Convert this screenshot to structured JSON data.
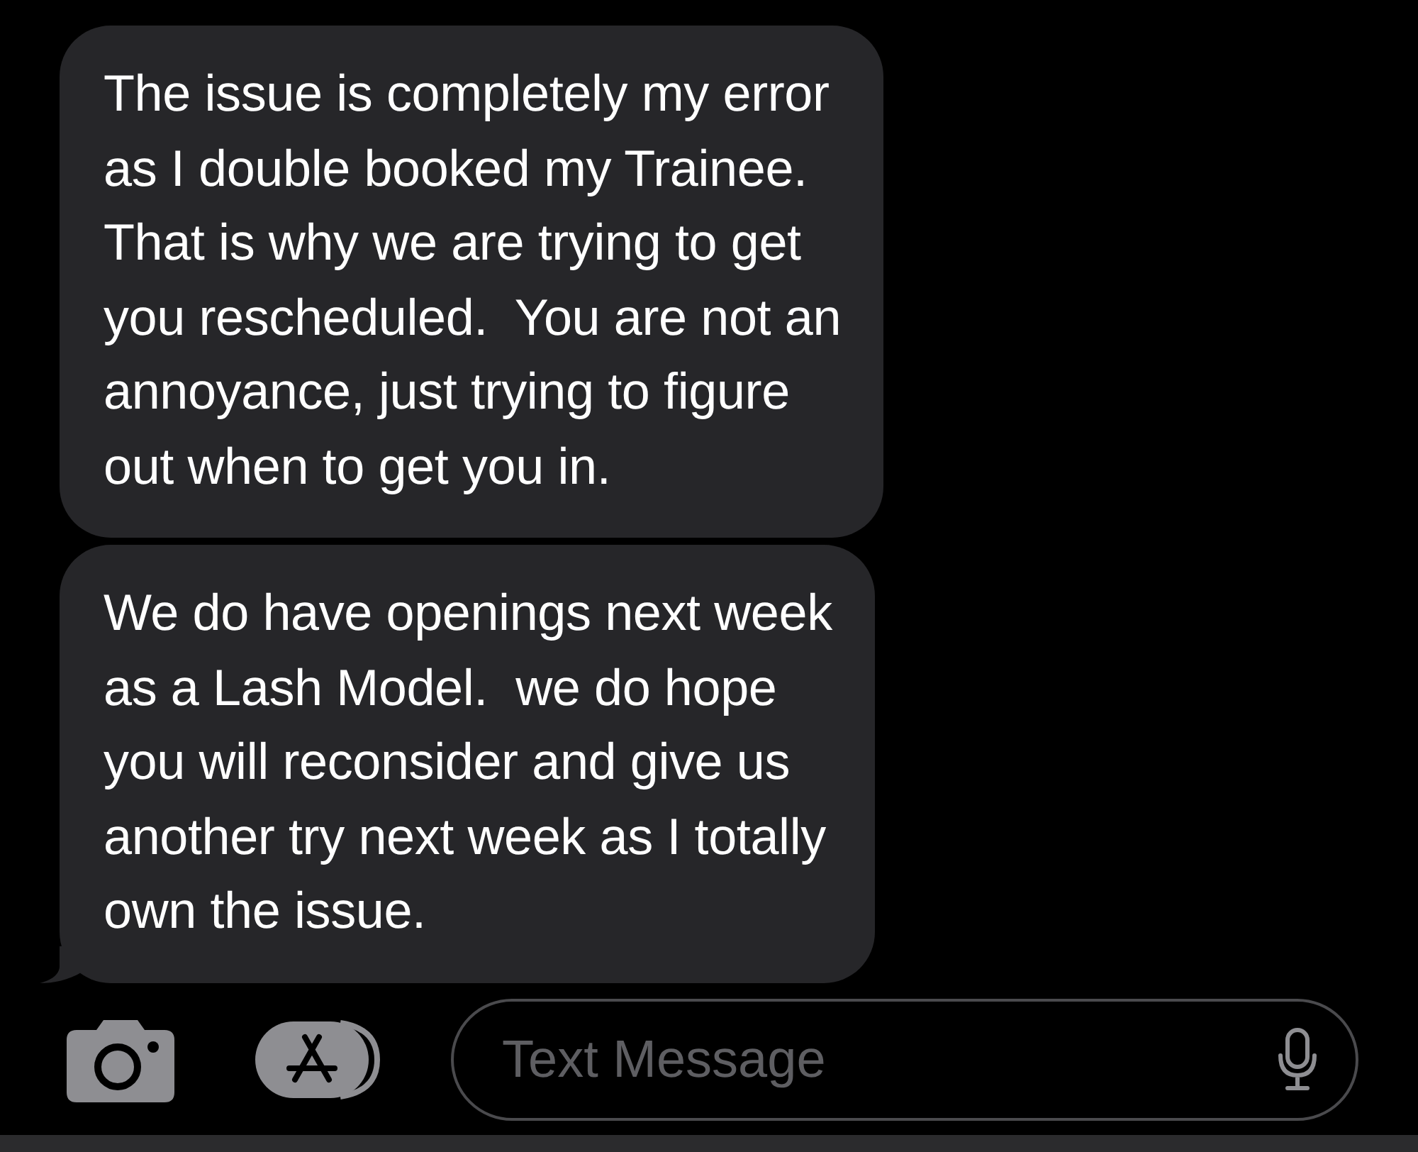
{
  "messages": [
    {
      "text": "The issue is completely my error\nas I double booked my Trainee.\nThat is why we are trying to get\nyou rescheduled.  You are not an\nannoyance, just trying to figure\nout when to get you in.",
      "tail": false
    },
    {
      "text": "We do have openings next week\nas a Lash Model.  we do hope\nyou will reconsider and give us\nanother try next week as I totally\nown the issue.",
      "tail": true
    }
  ],
  "composer": {
    "placeholder": "Text Message"
  }
}
